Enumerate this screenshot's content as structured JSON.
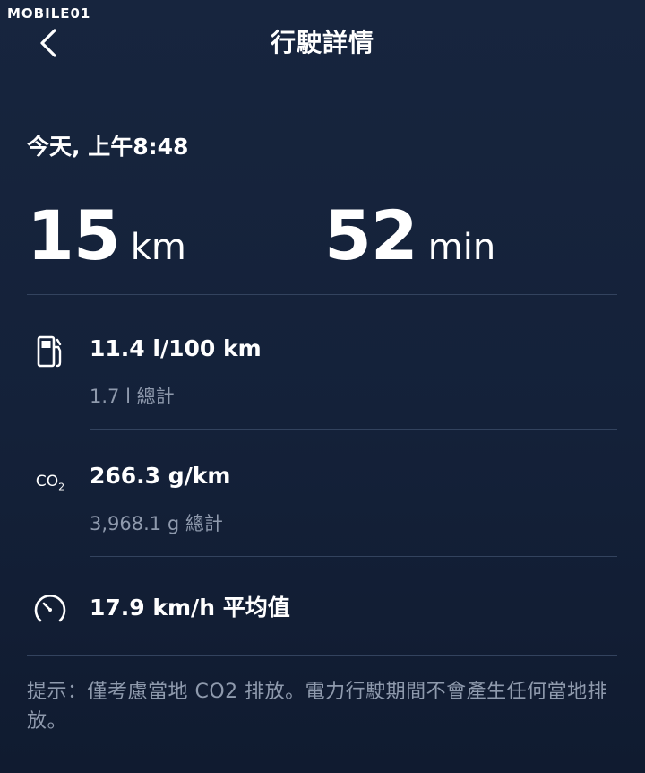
{
  "watermark": {
    "text": "MOBILE01"
  },
  "header": {
    "title": "行駛詳情"
  },
  "trip": {
    "datetime": "今天, 上午8:48",
    "distance_value": "15",
    "distance_unit": "km",
    "duration_value": "52",
    "duration_unit": "min"
  },
  "metrics": {
    "fuel": {
      "icon": "fuel-pump-icon",
      "value": "11.4 l/100 km",
      "sub": "1.7 l 總計"
    },
    "co2": {
      "icon": "co2-icon",
      "icon_label": "CO",
      "icon_sub": "2",
      "value": "266.3 g/km",
      "sub": "3,968.1 g 總計"
    },
    "speed": {
      "icon": "speedometer-icon",
      "value": "17.9 km/h 平均值"
    }
  },
  "note": "提示：僅考慮當地 CO2 排放。電力行駛期間不會產生任何當地排放。",
  "colors": {
    "background": "#15233b",
    "text": "#ffffff",
    "secondary": "#8f9aad",
    "divider": "#33435e"
  }
}
